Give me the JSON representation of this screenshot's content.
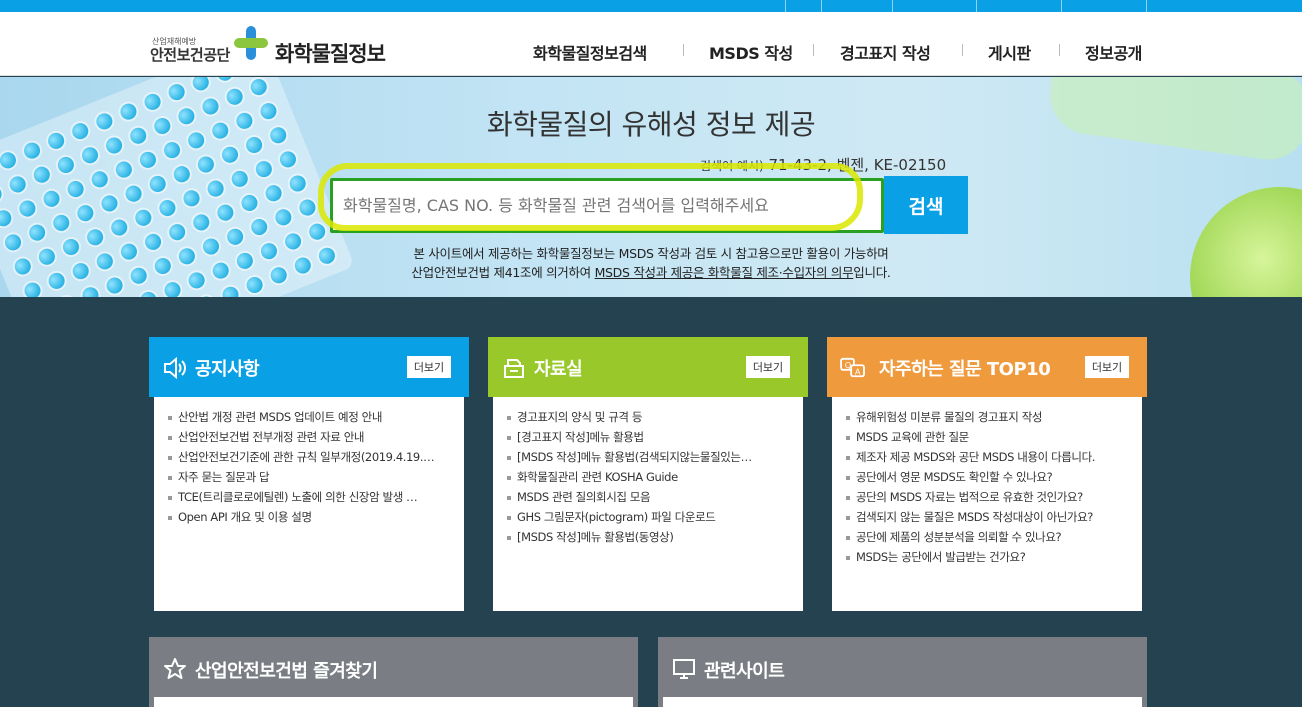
{
  "header": {
    "org_small": "산업재해예방",
    "org_name": "안전보건공단",
    "site_name": "화학물질정보",
    "nav": [
      "화학물질정보검색",
      "MSDS 작성",
      "경고표지 작성",
      "게시판",
      "정보공개"
    ]
  },
  "hero": {
    "title": "화학물질의 유해성 정보 제공",
    "hint_label": "검색어 예시)",
    "hint_examples": "71-43-2, 벤젠, KE-02150",
    "search_placeholder": "화학물질명, CAS NO. 등 화학물질 관련 검색어를 입력해주세요",
    "search_button": "검색",
    "notice_line1": "본 사이트에서 제공하는 화학물질정보는 MSDS 작성과 검토 시 참고용으로만 활용이 가능하며",
    "notice_line2_prefix": "산업안전보건법 제41조에 의거하여 ",
    "notice_line2_link": "MSDS 작성과 제공은 화학물질 제조·수입자의 의무",
    "notice_line2_suffix": "입니다."
  },
  "panels": [
    {
      "title": "공지사항",
      "more": "더보기",
      "color": "#0aa0e6",
      "items": [
        "산안법 개정 관련 MSDS 업데이트 예정 안내",
        "산업안전보건법 전부개정 관련 자료 안내",
        "산업안전보건기준에 관한 규칙 일부개정(2019.4.19.…",
        "자주 묻는 질문과 답",
        "TCE(트리클로로에틸렌) 노출에 의한 신장암 발생 …",
        "Open API 개요 및 이용 설명"
      ]
    },
    {
      "title": "자료실",
      "more": "더보기",
      "color": "#98c82a",
      "items": [
        "경고표지의 양식 및 규격 등",
        "[경고표지 작성]메뉴 활용법",
        "[MSDS 작성]메뉴 활용법(검색되지않는물질있는…",
        "화학물질관리 관련 KOSHA Guide",
        "MSDS 관련 질의회시집 모음",
        "GHS 그림문자(pictogram) 파일 다운로드",
        "[MSDS 작성]메뉴 활용법(동영상)"
      ]
    },
    {
      "title": "자주하는 질문 TOP10",
      "more": "더보기",
      "color": "#ef9a3d",
      "items": [
        "유해위험성 미분류 물질의 경고표지 작성",
        "MSDS 교육에 관한 질문",
        "제조자 제공 MSDS와 공단 MSDS 내용이 다릅니다.",
        "공단에서 영문 MSDS도 확인할 수 있나요?",
        "공단의 MSDS 자료는 법적으로 유효한 것인가요?",
        "검색되지 않는 물질은 MSDS 작성대상이 아닌가요?",
        "공단에 제품의 성분분석을 의뢰할 수 있나요?",
        "MSDS는 공단에서 발급받는 건가요?"
      ]
    }
  ],
  "bottom": {
    "favorites_title": "산업안전보건법 즐겨찾기",
    "related_title": "관련사이트"
  }
}
